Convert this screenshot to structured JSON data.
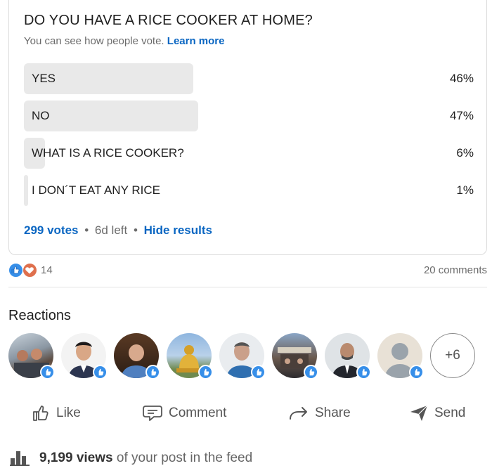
{
  "poll": {
    "question": "DO YOU HAVE A RICE COOKER AT HOME?",
    "subtitle": "You can see how people vote.",
    "learn_more": "Learn more",
    "options": [
      {
        "label": "YES",
        "percent_text": "46%",
        "percent": 46
      },
      {
        "label": "NO",
        "percent_text": "47%",
        "percent": 47
      },
      {
        "label": "WHAT IS A RICE COOKER?",
        "percent_text": "6%",
        "percent": 6
      },
      {
        "label": "I DON´T EAT ANY RICE",
        "percent_text": "1%",
        "percent": 1
      }
    ],
    "votes": "299 votes",
    "time_left": "6d left",
    "hide_results": "Hide results"
  },
  "social": {
    "reaction_count": "14",
    "comments": "20 comments",
    "reaction_icons": [
      "like-icon",
      "heart-icon"
    ]
  },
  "reactions": {
    "title": "Reactions",
    "more": "+6",
    "avatars": [
      "avatar-1",
      "avatar-2",
      "avatar-3",
      "avatar-4",
      "avatar-5",
      "avatar-6",
      "avatar-7",
      "avatar-8"
    ]
  },
  "actions": {
    "like": "Like",
    "comment": "Comment",
    "share": "Share",
    "send": "Send"
  },
  "views": {
    "count": "9,199 views",
    "suffix": "of your post in the feed"
  },
  "colors": {
    "link": "#0a66c2",
    "bar": "#e9e9e9",
    "like_badge": "#378fe9",
    "heart": "#df704d"
  }
}
